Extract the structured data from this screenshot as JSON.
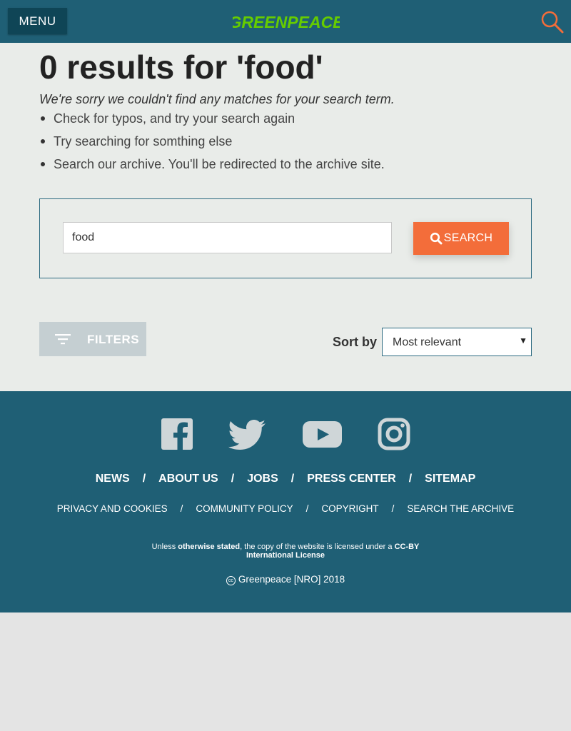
{
  "header": {
    "menu_label": "MENU",
    "logo_text": "GREENPEACE",
    "colors": {
      "bar": "#1f5f75",
      "logo": "#66cc00"
    }
  },
  "results": {
    "title": "0 results for 'food'",
    "sorry": "We're sorry we couldn't find any matches for your search term.",
    "tips": [
      "Check for typos, and try your search again",
      "Try searching for somthing else",
      "Search our archive. You'll be redirected to the archive site."
    ]
  },
  "search": {
    "value": "food",
    "button_label": "SEARCH",
    "button_color": "#f36d3a"
  },
  "controls": {
    "filters_label": "FILTERS",
    "sort_label": "Sort by",
    "sort_selected": "Most relevant"
  },
  "footer": {
    "social": [
      "facebook-icon",
      "twitter-icon",
      "youtube-icon",
      "instagram-icon"
    ],
    "primary_links": [
      "NEWS",
      "ABOUT US",
      "JOBS",
      "PRESS CENTER",
      "SITEMAP"
    ],
    "secondary_links": [
      "PRIVACY AND COOKIES",
      "COMMUNITY POLICY",
      "COPYRIGHT",
      "SEARCH THE ARCHIVE"
    ],
    "license": {
      "prefix": "Unless ",
      "stated": "otherwise stated",
      "middle": ", the copy of the website is licensed under a ",
      "ccby": "CC-BY",
      "intl": "International License"
    },
    "copyright": "Greenpeace [NRO] 2018",
    "cc_symbol": "cc"
  }
}
